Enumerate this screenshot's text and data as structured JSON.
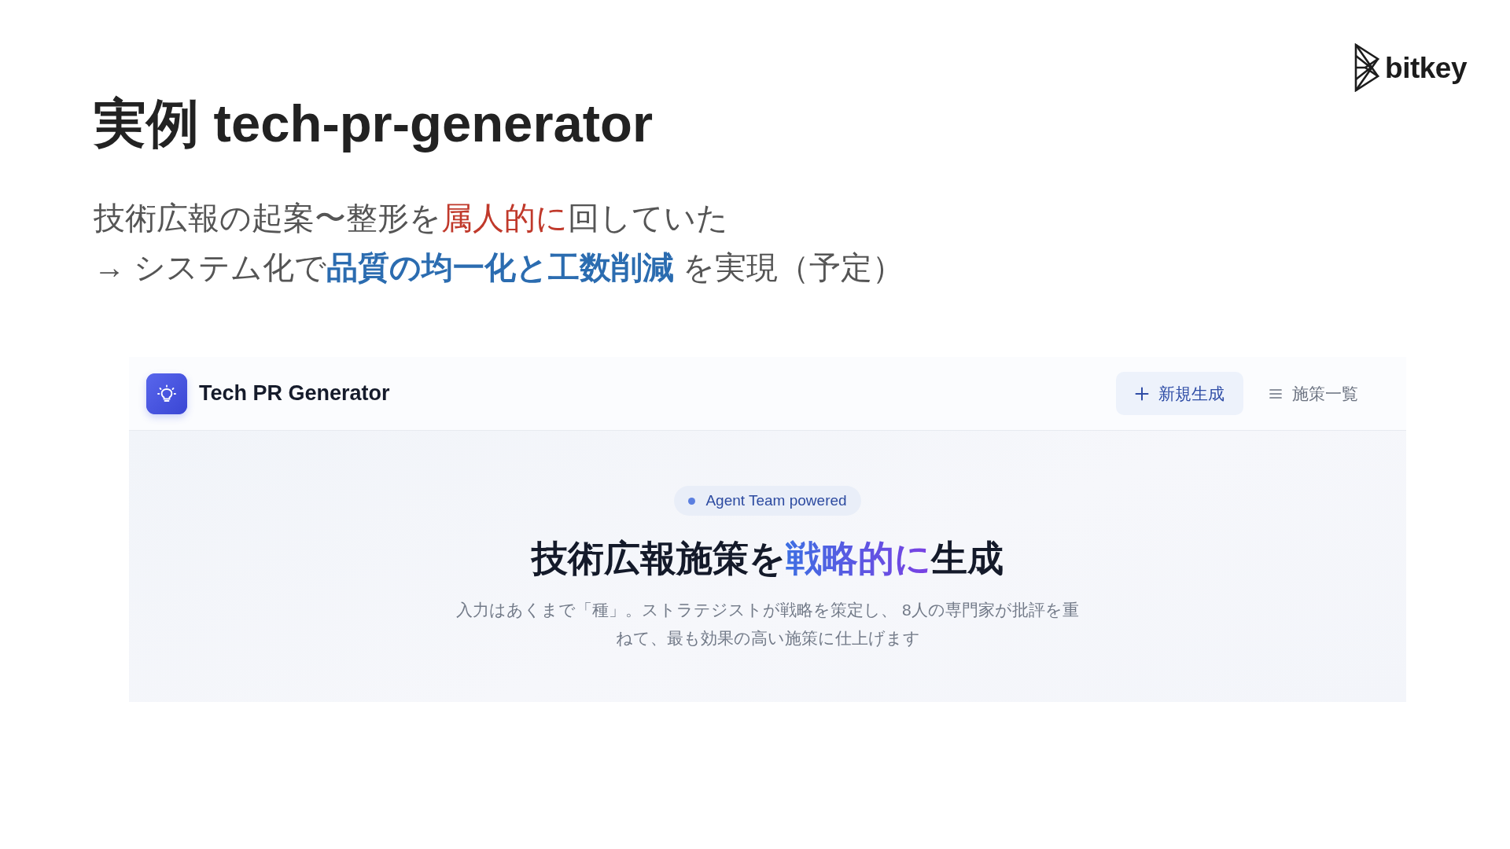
{
  "slide": {
    "title": "実例 tech-pr-generator",
    "logo": {
      "text": "bitkey"
    },
    "lines": [
      {
        "segments": [
          {
            "kind": "plain",
            "text": "技術広報の起案〜整形を"
          },
          {
            "kind": "alert",
            "text": "属人的に"
          },
          {
            "kind": "plain",
            "text": "回していた"
          }
        ]
      },
      {
        "segments": [
          {
            "kind": "plain",
            "text": "→ システム化で"
          },
          {
            "kind": "strong",
            "text": "品質の均一化と工数削減"
          },
          {
            "kind": "plain",
            "text": " を実現（予定）"
          }
        ]
      }
    ]
  },
  "app": {
    "brand": "Tech PR Generator",
    "nav": [
      {
        "label": "新規生成",
        "selected": true
      },
      {
        "label": "施策一覧",
        "selected": false
      }
    ],
    "badge": "Agent Team powered",
    "heading": [
      {
        "kind": "plain",
        "text": "技術広報施策を"
      },
      {
        "kind": "gradient",
        "text": "戦略的に"
      },
      {
        "kind": "plain",
        "text": "生成"
      }
    ],
    "description": "入力はあくまで「種」。ストラテジストが戦略を策定し、 8人の専門家が批評を重ねて、最も効果の高い施策に仕上げます"
  }
}
